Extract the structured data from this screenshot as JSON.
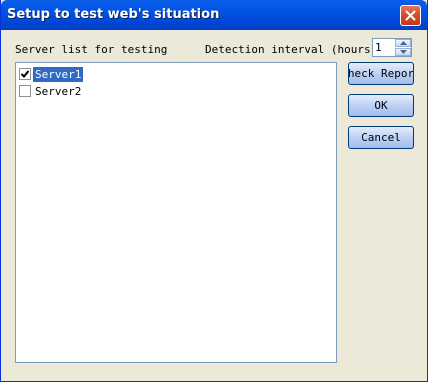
{
  "window": {
    "title": "Setup to test web's situation",
    "close_icon": "close-icon"
  },
  "labels": {
    "server_list": "Server list for testing",
    "detection_interval": "Detection interval (hours)"
  },
  "interval": {
    "value": "1"
  },
  "servers": [
    {
      "name": "Server1",
      "checked": true,
      "selected": true
    },
    {
      "name": "Server2",
      "checked": false,
      "selected": false
    }
  ],
  "buttons": {
    "check_report": "Check Report",
    "ok": "OK",
    "cancel": "Cancel"
  },
  "colors": {
    "titlebar": "#0054e3",
    "selection": "#316ac5",
    "close": "#d8482a"
  }
}
